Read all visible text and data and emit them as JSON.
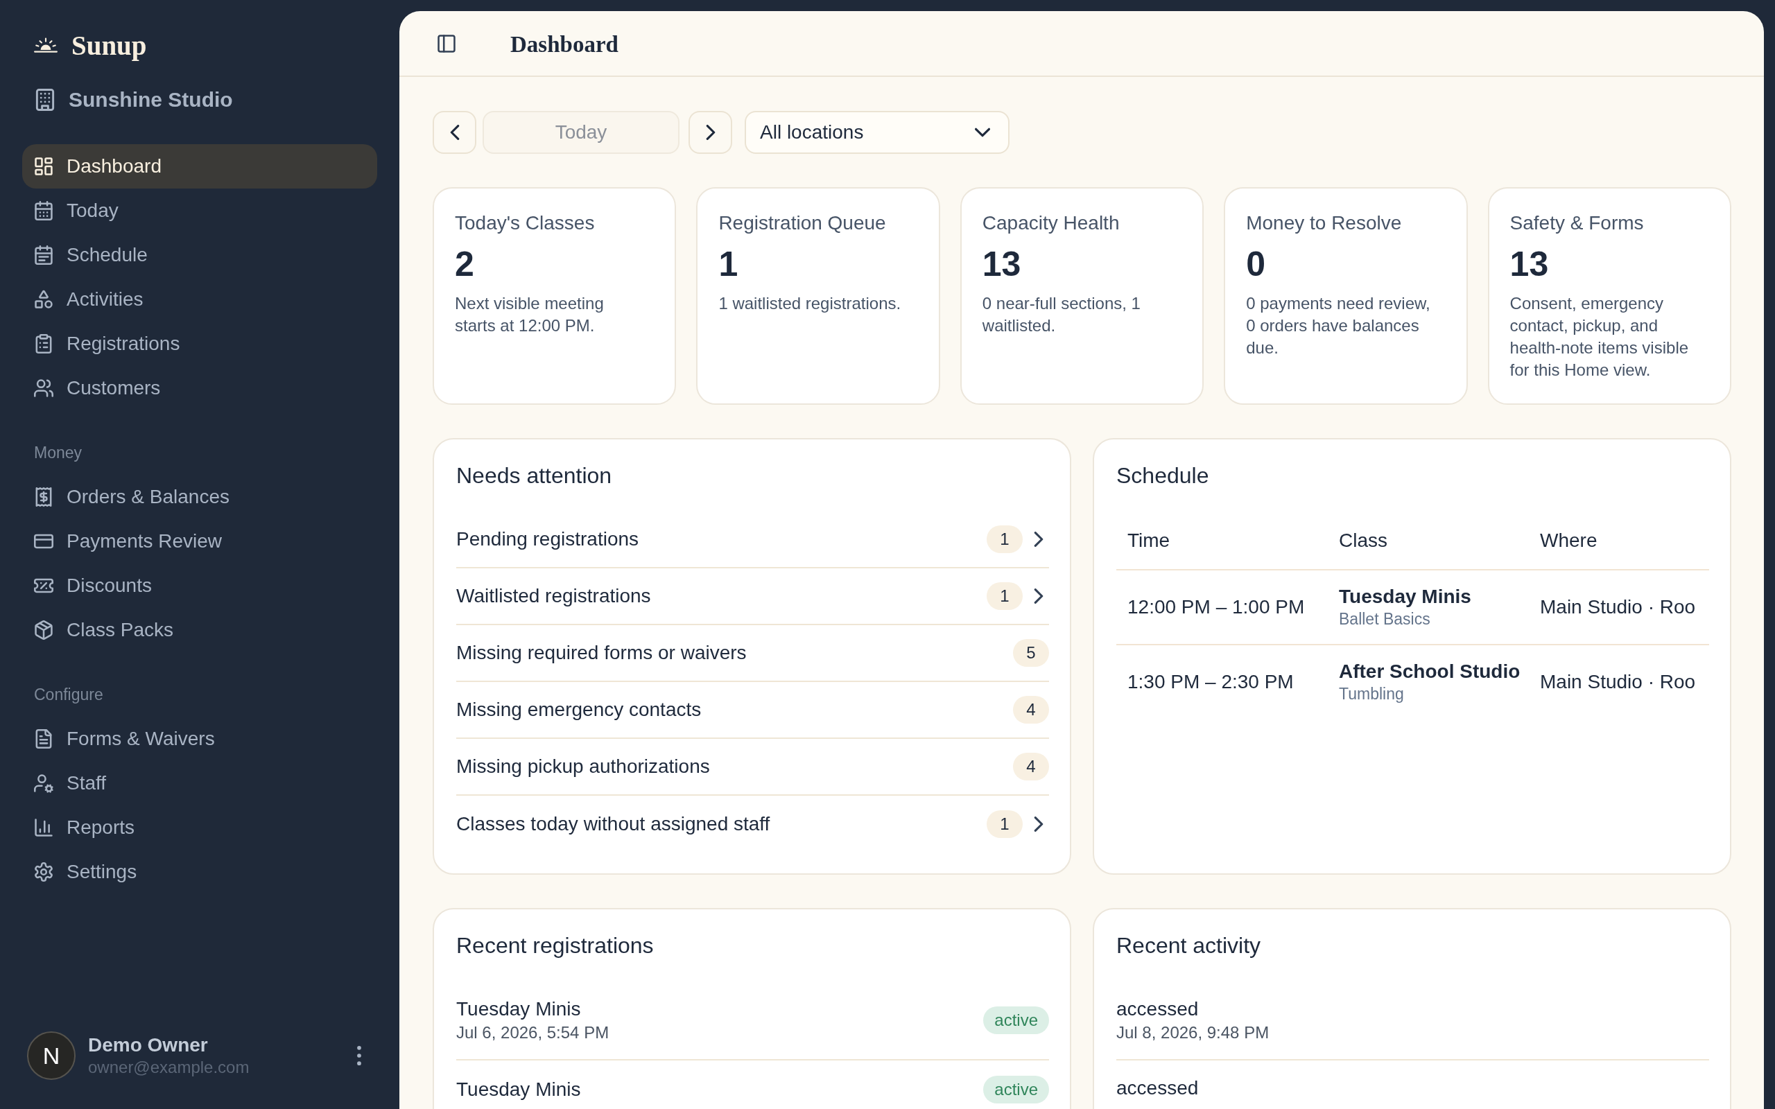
{
  "sidebar": {
    "brand": "Sunup",
    "workspace": "Sunshine Studio",
    "sections": [
      {
        "items": [
          {
            "label": "Dashboard",
            "selected": true
          },
          {
            "label": "Today",
            "selected": false
          },
          {
            "label": "Schedule",
            "selected": false
          },
          {
            "label": "Activities",
            "selected": false
          },
          {
            "label": "Registrations",
            "selected": false
          },
          {
            "label": "Customers",
            "selected": false
          }
        ]
      },
      {
        "heading": "Money",
        "items": [
          {
            "label": "Orders & Balances",
            "selected": false
          },
          {
            "label": "Payments Review",
            "selected": false
          },
          {
            "label": "Discounts",
            "selected": false
          },
          {
            "label": "Class Packs",
            "selected": false
          }
        ]
      },
      {
        "heading": "Configure",
        "items": [
          {
            "label": "Forms & Waivers",
            "selected": false
          },
          {
            "label": "Staff",
            "selected": false
          },
          {
            "label": "Reports",
            "selected": false
          },
          {
            "label": "Settings",
            "selected": false
          }
        ]
      }
    ],
    "user": {
      "avatar_letter": "N",
      "name": "Demo Owner",
      "email": "owner@example.com"
    }
  },
  "header": {
    "title": "Dashboard"
  },
  "toolbar": {
    "today": {
      "label": "Today",
      "disabled": true
    },
    "location": "All locations"
  },
  "stats": [
    {
      "label": "Today's Classes",
      "value": "2",
      "note": "Next visible meeting starts at 12:00 PM."
    },
    {
      "label": "Registration Queue",
      "value": "1",
      "note": "1 waitlisted registrations."
    },
    {
      "label": "Capacity Health",
      "value": "13",
      "note": "0 near-full sections, 1 waitlisted."
    },
    {
      "label": "Money to Resolve",
      "value": "0",
      "note": "0 payments need review, 0 orders have balances due."
    },
    {
      "label": "Safety & Forms",
      "value": "13",
      "note": "Consent, emergency contact, pickup, and health-note items visible for this Home view."
    }
  ],
  "needs_attention": {
    "title": "Needs attention",
    "items": [
      {
        "label": "Pending registrations",
        "count": "1",
        "kind": "link"
      },
      {
        "label": "Waitlisted registrations",
        "count": "1",
        "kind": "link"
      },
      {
        "label": "Missing required forms or waivers",
        "count": "5",
        "kind": "count"
      },
      {
        "label": "Missing emergency contacts",
        "count": "4",
        "kind": "count"
      },
      {
        "label": "Missing pickup authorizations",
        "count": "4",
        "kind": "count"
      },
      {
        "label": "Classes today without assigned staff",
        "count": "1",
        "kind": "link"
      }
    ]
  },
  "schedule": {
    "title": "Schedule",
    "columns": [
      "Time",
      "Class",
      "Where"
    ],
    "rows": [
      {
        "time": "12:00 PM – 1:00 PM",
        "class": "Tuesday Minis",
        "activity": "Ballet Basics",
        "where": "Main Studio · Roo"
      },
      {
        "time": "1:30 PM – 2:30 PM",
        "class": "After School Studio",
        "activity": "Tumbling",
        "where": "Main Studio · Roo"
      }
    ]
  },
  "recent_registrations": {
    "title": "Recent registrations",
    "items": [
      {
        "name": "Tuesday Minis",
        "date": "Jul 6, 2026, 5:54 PM",
        "status": "active"
      },
      {
        "name": "Tuesday Minis",
        "status": "active"
      }
    ]
  },
  "recent_activity": {
    "title": "Recent activity",
    "items": [
      {
        "action": "accessed",
        "date": "Jul 8, 2026, 9:48 PM"
      },
      {
        "action": "accessed"
      }
    ]
  }
}
